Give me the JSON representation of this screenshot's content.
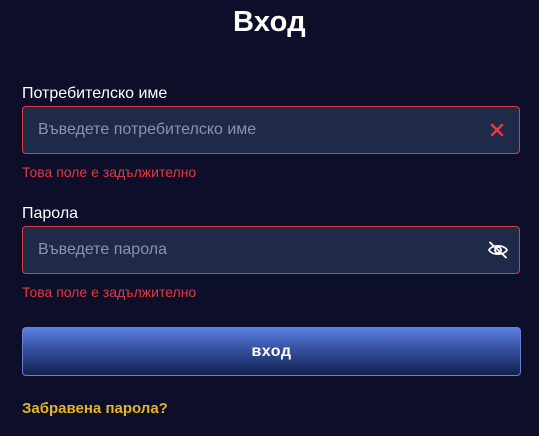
{
  "title": "Вход",
  "username": {
    "label": "Потребителско име",
    "placeholder": "Въведете потребителско име",
    "value": "",
    "error": "Това поле е задължително",
    "icon": "clear-x-icon"
  },
  "password": {
    "label": "Парола",
    "placeholder": "Въведете парола",
    "value": "",
    "error": "Това поле е задължително",
    "icon": "eye-slash-icon"
  },
  "submit_label": "вход",
  "forgot_password_label": "Забравена парола?",
  "colors": {
    "background": "#0c0e2a",
    "field_background": "#1f2a48",
    "error": "#e23a3e",
    "link": "#e6b422",
    "button_top": "#5b7fe3",
    "button_bottom": "#13214f"
  }
}
